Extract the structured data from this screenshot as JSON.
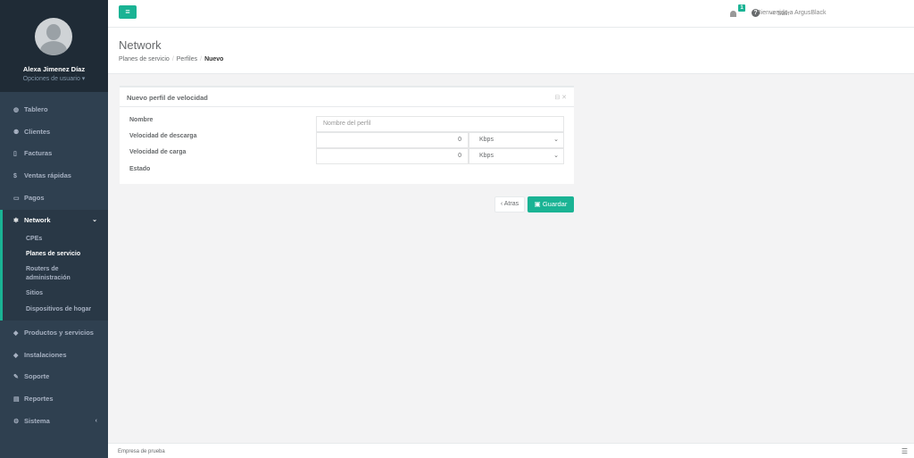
{
  "sidebar": {
    "user_name": "Alexa Jimenez Díaz",
    "user_options": "Opciones de usuario ▾",
    "items": [
      {
        "icon": "dashboard-icon",
        "glyph": "◍",
        "label": "Tablero"
      },
      {
        "icon": "users-icon",
        "glyph": "⚉",
        "label": "Clientes"
      },
      {
        "icon": "file-icon",
        "glyph": "▯",
        "label": "Facturas"
      },
      {
        "icon": "dollar-icon",
        "glyph": "$",
        "label": "Ventas rápidas"
      },
      {
        "icon": "card-icon",
        "glyph": "▭",
        "label": "Pagos"
      },
      {
        "icon": "network-icon",
        "glyph": "✻",
        "label": "Network"
      },
      {
        "icon": "tags-icon",
        "glyph": "◆",
        "label": "Productos y servicios"
      },
      {
        "icon": "tag-icon",
        "glyph": "◆",
        "label": "Instalaciones"
      },
      {
        "icon": "wrench-icon",
        "glyph": "✎",
        "label": "Soporte"
      },
      {
        "icon": "book-icon",
        "glyph": "▤",
        "label": "Reportes"
      },
      {
        "icon": "gears-icon",
        "glyph": "⚙",
        "label": "Sistema"
      }
    ],
    "network_sub": [
      "CPEs",
      "Planes de servicio",
      "Routers de administración",
      "Sitios",
      "Dispositivos de hogar"
    ]
  },
  "topbar": {
    "menu_glyph": "≡",
    "welcome": "Bienvenido a ArgusBlack",
    "notif_count": "1",
    "help_glyph": "?",
    "logout": "⇨ Salir"
  },
  "heading": {
    "title": "Network",
    "crumb1": "Planes de servicio",
    "crumb2": "Perfiles",
    "crumb3": "Nuevo",
    "sep": "/"
  },
  "panel": {
    "title": "Nuevo perfil de velocidad",
    "tools": "⊟ ✕",
    "labels": [
      "Nombre",
      "Velocidad de descarga",
      "Velocidad de carga",
      "Estado"
    ],
    "name_placeholder": "Nombre del perfil",
    "download_value": "0",
    "upload_value": "0",
    "download_unit": "Kbps",
    "upload_unit": "Kbps",
    "caret": "⌄"
  },
  "actions": {
    "back": "‹ Atras",
    "save": "▣ Guardar"
  },
  "footer": {
    "company": "Empresa de prueba",
    "icon_glyph": "☰"
  },
  "colors": {
    "accent": "#1ab394",
    "sidebar": "#2f4050"
  }
}
